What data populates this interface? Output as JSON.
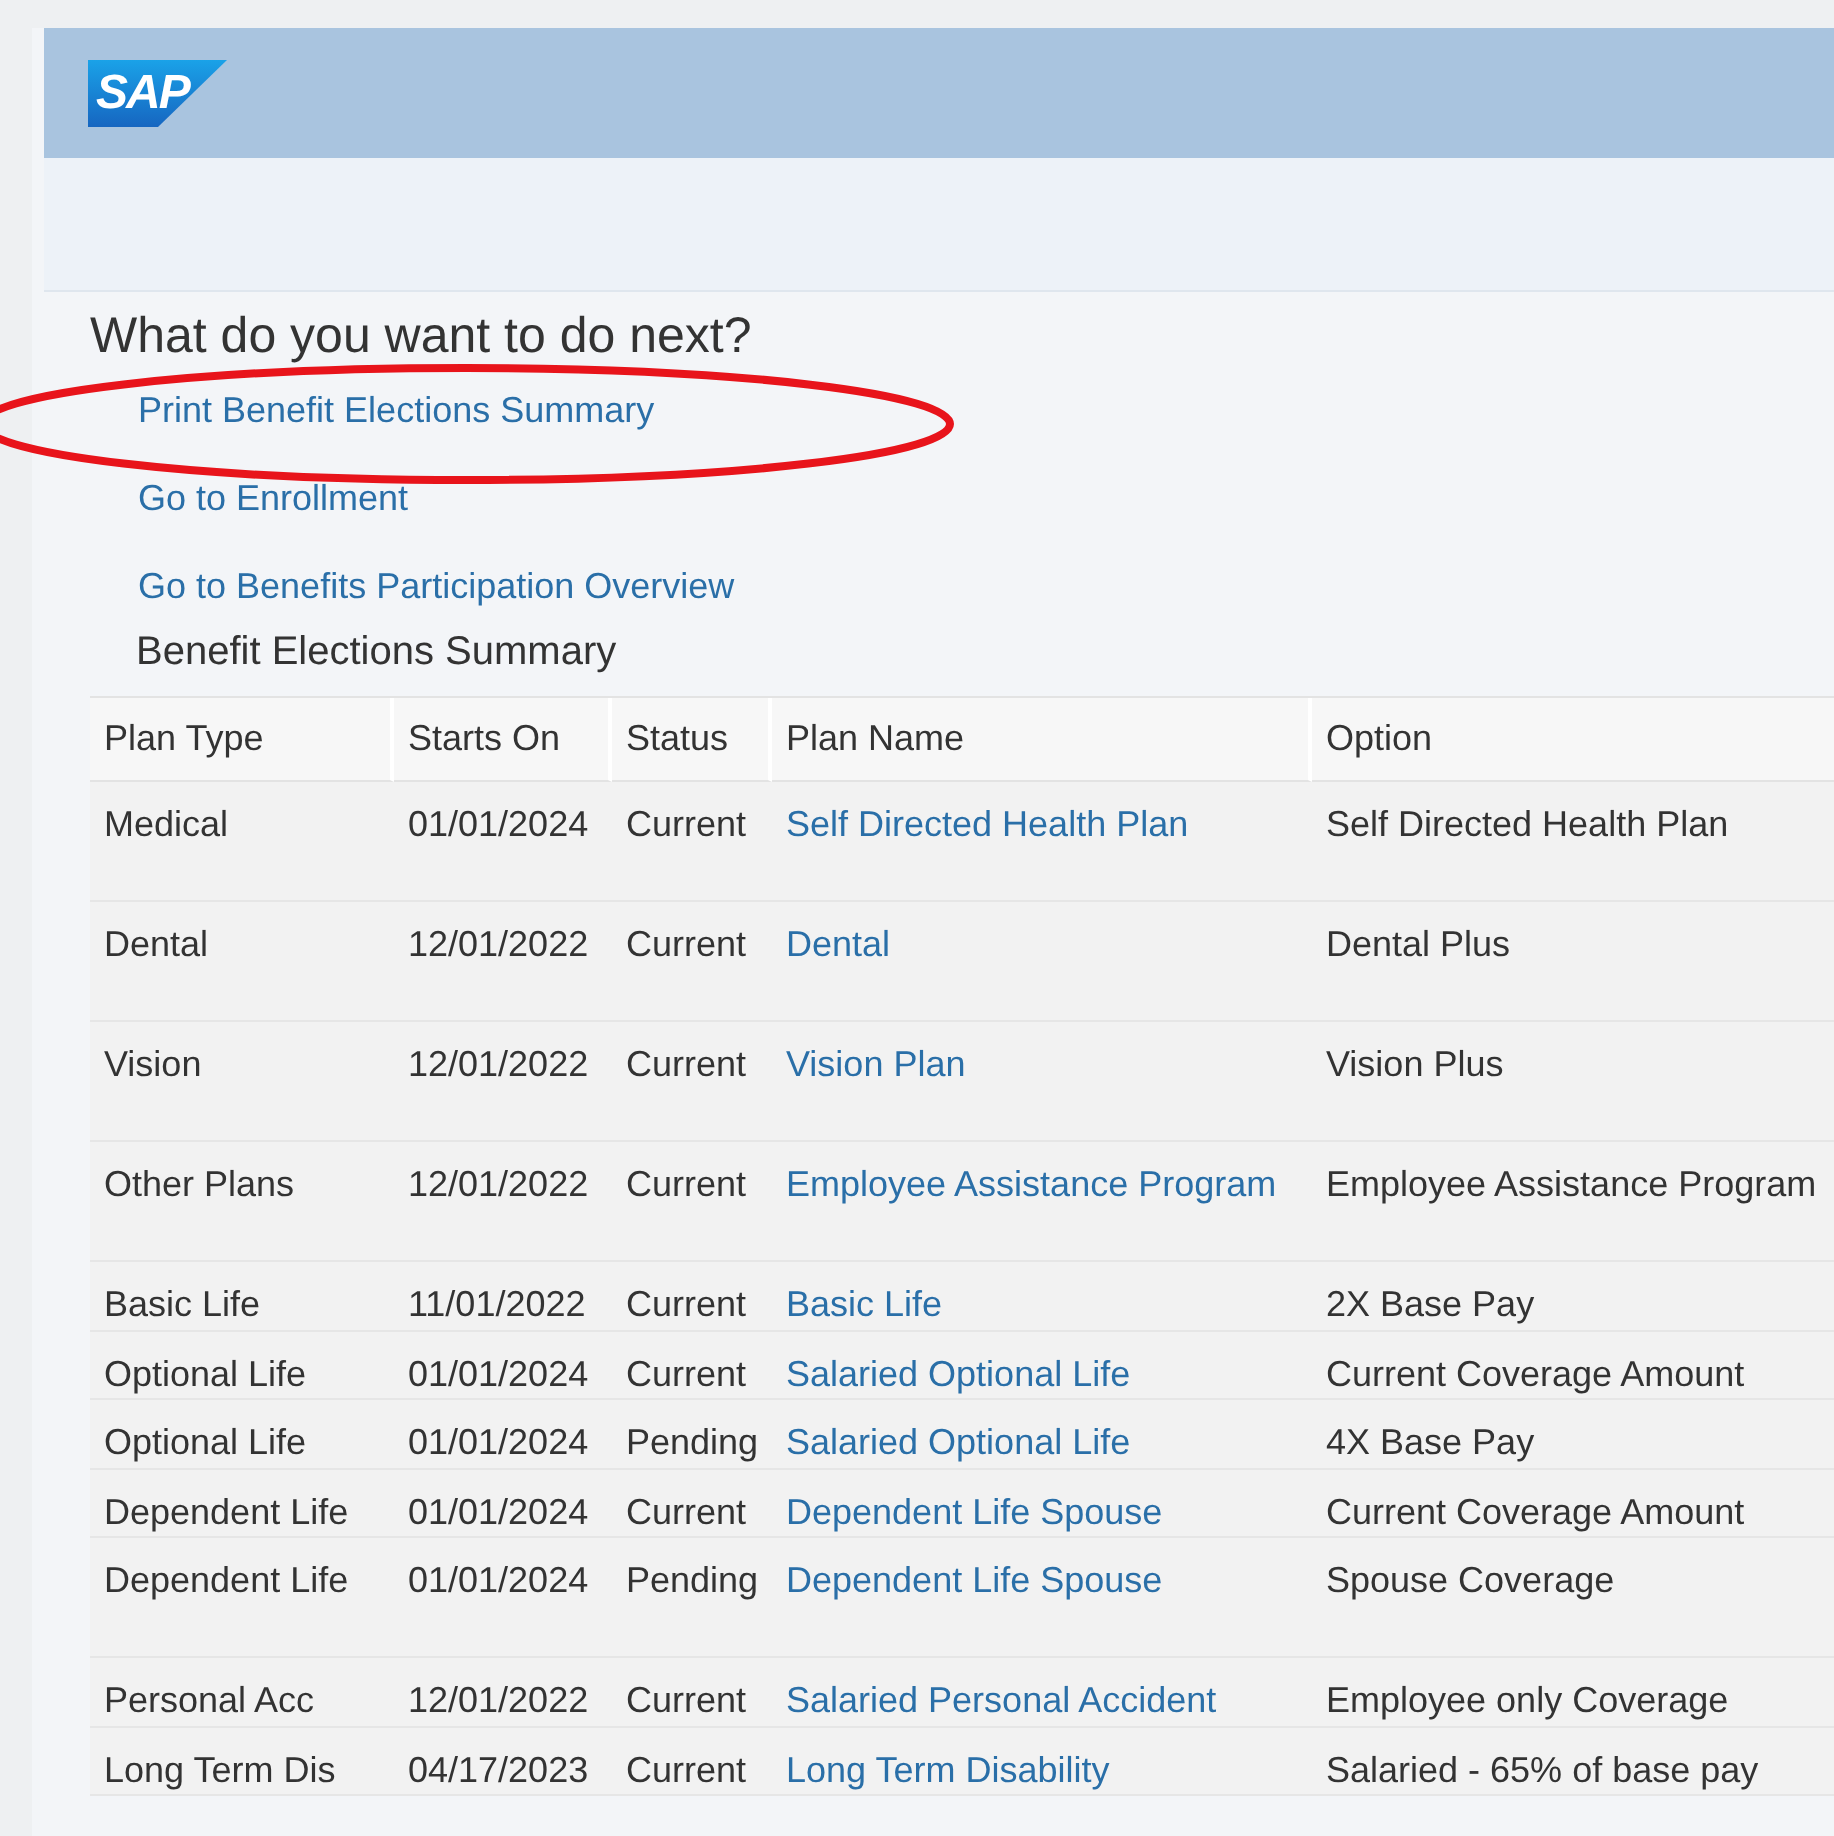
{
  "header": {
    "logo": "SAP"
  },
  "prompt": "What do you want to do next?",
  "actions": [
    {
      "label": "Print Benefit Elections Summary"
    },
    {
      "label": "Go to Enrollment"
    },
    {
      "label": "Go to Benefits Participation Overview"
    }
  ],
  "annotation": {
    "kind": "ellipse"
  },
  "section_title": "Benefit Elections Summary",
  "table": {
    "columns": [
      "Plan Type",
      "Starts On",
      "Status",
      "Plan Name",
      "Option"
    ],
    "rows": [
      {
        "plan_type": "Medical",
        "starts_on": "01/01/2024",
        "status": "Current",
        "plan_name": "Self Directed Health Plan",
        "option": "Self Directed Health Plan"
      },
      {
        "plan_type": "Dental",
        "starts_on": "12/01/2022",
        "status": "Current",
        "plan_name": "Dental",
        "option": "Dental Plus"
      },
      {
        "plan_type": "Vision",
        "starts_on": "12/01/2022",
        "status": "Current",
        "plan_name": "Vision Plan",
        "option": "Vision Plus"
      },
      {
        "plan_type": "Other Plans",
        "starts_on": "12/01/2022",
        "status": "Current",
        "plan_name": "Employee Assistance Program",
        "option": "Employee Assistance Program"
      },
      {
        "plan_type": "Basic Life",
        "starts_on": "11/01/2022",
        "status": "Current",
        "plan_name": "Basic Life",
        "option": "2X Base Pay"
      },
      {
        "plan_type": "Optional Life",
        "starts_on": "01/01/2024",
        "status": "Current",
        "plan_name": "Salaried Optional Life",
        "option": "Current Coverage Amount"
      },
      {
        "plan_type": "Optional Life",
        "starts_on": "01/01/2024",
        "status": "Pending",
        "plan_name": "Salaried Optional Life",
        "option": "4X Base Pay"
      },
      {
        "plan_type": "Dependent Life",
        "starts_on": "01/01/2024",
        "status": "Current",
        "plan_name": "Dependent Life Spouse",
        "option": "Current Coverage Amount"
      },
      {
        "plan_type": "Dependent Life",
        "starts_on": "01/01/2024",
        "status": "Pending",
        "plan_name": "Dependent Life Spouse",
        "option": "Spouse Coverage"
      },
      {
        "plan_type": "Personal Acc",
        "starts_on": "12/01/2022",
        "status": "Current",
        "plan_name": "Salaried Personal Accident",
        "option": "Employee only Coverage"
      },
      {
        "plan_type": "Long Term Dis",
        "starts_on": "04/17/2023",
        "status": "Current",
        "plan_name": "Long Term Disability",
        "option": "Salaried - 65% of base pay"
      }
    ]
  }
}
